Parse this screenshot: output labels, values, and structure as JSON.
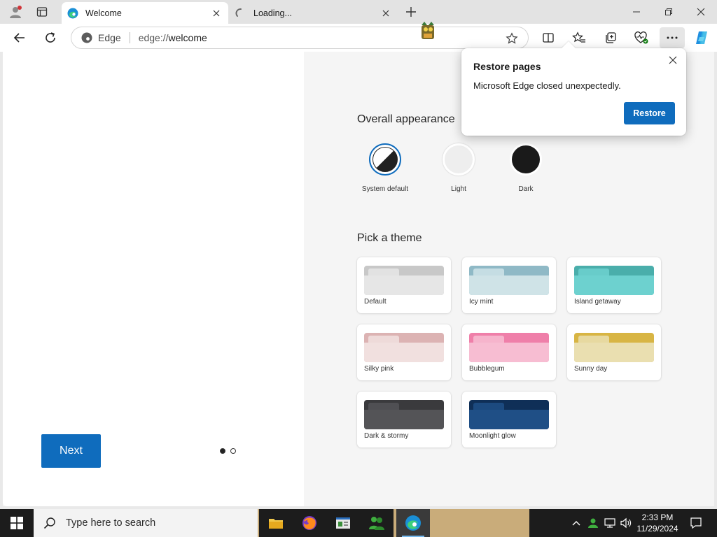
{
  "tabs": [
    {
      "title": "Welcome",
      "active": true
    },
    {
      "title": "Loading...",
      "active": false
    }
  ],
  "address": {
    "site_label": "Edge",
    "url_prefix": "edge://",
    "url_host": "welcome"
  },
  "welcome": {
    "next_label": "Next",
    "appearance_title": "Overall appearance",
    "appearance_options": [
      {
        "label": "System default",
        "selected": true
      },
      {
        "label": "Light",
        "selected": false
      },
      {
        "label": "Dark",
        "selected": false
      }
    ],
    "theme_title": "Pick a theme",
    "themes": [
      {
        "label": "Default",
        "back": "#c8c8c8",
        "front": "#e6e6e6"
      },
      {
        "label": "Icy mint",
        "back": "#8fb9c6",
        "front": "#cfe3e7"
      },
      {
        "label": "Island getaway",
        "back": "#4aaeab",
        "front": "#6dd1cf"
      },
      {
        "label": "Silky pink",
        "back": "#dcb3b3",
        "front": "#f1e0df"
      },
      {
        "label": "Bubblegum",
        "back": "#ef7fa9",
        "front": "#f7bdd2"
      },
      {
        "label": "Sunny day",
        "back": "#d8b544",
        "front": "#eadfb0"
      },
      {
        "label": "Dark & stormy",
        "back": "#3a3a3d",
        "front": "#545457"
      },
      {
        "label": "Moonlight glow",
        "back": "#0f2f57",
        "front": "#1f4f86"
      }
    ]
  },
  "popup": {
    "title": "Restore pages",
    "message": "Microsoft Edge closed unexpectedly.",
    "restore_label": "Restore"
  },
  "taskbar": {
    "search_placeholder": "Type here to search",
    "time": "2:33 PM",
    "date": "11/29/2024"
  },
  "colors": {
    "accent": "#0f6cbd",
    "taskbar": "#1c1c1c"
  }
}
